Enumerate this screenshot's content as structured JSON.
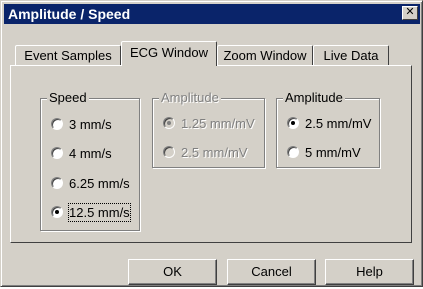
{
  "window": {
    "title": "Amplitude / Speed",
    "close_glyph": "✕"
  },
  "tabs": [
    {
      "label": "Event Samples",
      "active": false
    },
    {
      "label": "ECG Window",
      "active": true
    },
    {
      "label": "Zoom Window",
      "active": false
    },
    {
      "label": "Live Data",
      "active": false
    }
  ],
  "speed": {
    "label": "Speed",
    "options": [
      {
        "label": "3 mm/s",
        "checked": false
      },
      {
        "label": "4 mm/s",
        "checked": false
      },
      {
        "label": "6.25 mm/s",
        "checked": false
      },
      {
        "label": "12.5 mm/s",
        "checked": true
      }
    ]
  },
  "amplitude_disabled": {
    "label": "Amplitude",
    "options": [
      {
        "label": "1.25 mm/mV",
        "checked": true
      },
      {
        "label": "2.5 mm/mV",
        "checked": false
      }
    ]
  },
  "amplitude": {
    "label": "Amplitude",
    "options": [
      {
        "label": "2.5 mm/mV",
        "checked": true
      },
      {
        "label": "5 mm/mV",
        "checked": false
      }
    ]
  },
  "buttons": {
    "ok": "OK",
    "cancel": "Cancel",
    "help": "Help"
  },
  "colors": {
    "titlebar": "#0a246a",
    "face": "#d4d0c8"
  }
}
